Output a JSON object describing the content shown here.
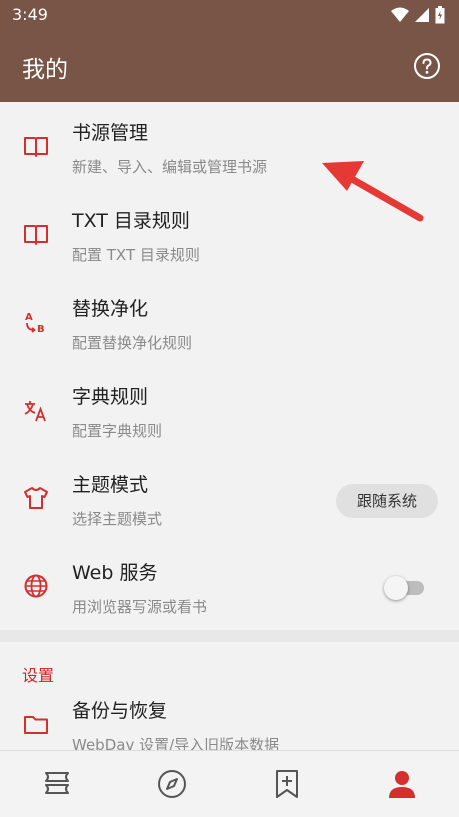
{
  "status": {
    "time": "3:49"
  },
  "appbar": {
    "title": "我的"
  },
  "items": [
    {
      "title": "书源管理",
      "subtitle": "新建、导入、编辑或管理书源",
      "icon": "book-open-icon"
    },
    {
      "title": "TXT 目录规则",
      "subtitle": "配置 TXT 目录规则",
      "icon": "book-open-icon"
    },
    {
      "title": "替换净化",
      "subtitle": "配置替换净化规则",
      "icon": "replace-ab-icon"
    },
    {
      "title": "字典规则",
      "subtitle": "配置字典规则",
      "icon": "translate-icon"
    },
    {
      "title": "主题模式",
      "subtitle": "选择主题模式",
      "icon": "tshirt-icon",
      "value": "跟随系统"
    },
    {
      "title": "Web 服务",
      "subtitle": "用浏览器写源或看书",
      "icon": "globe-icon",
      "toggle": false
    }
  ],
  "settings": {
    "header": "设置",
    "items": [
      {
        "title": "备份与恢复",
        "subtitle": "WebDav 设置/导入旧版本数据",
        "icon": "folder-icon"
      }
    ]
  },
  "bottom_nav": [
    {
      "icon": "bookshelf-icon"
    },
    {
      "icon": "compass-icon"
    },
    {
      "icon": "bookmark-add-icon"
    },
    {
      "icon": "person-icon",
      "active": true
    }
  ],
  "colors": {
    "primary": "#795548",
    "accent": "#d32f2f",
    "nav_active": "#d32f2f",
    "arrow": "#e53935"
  }
}
